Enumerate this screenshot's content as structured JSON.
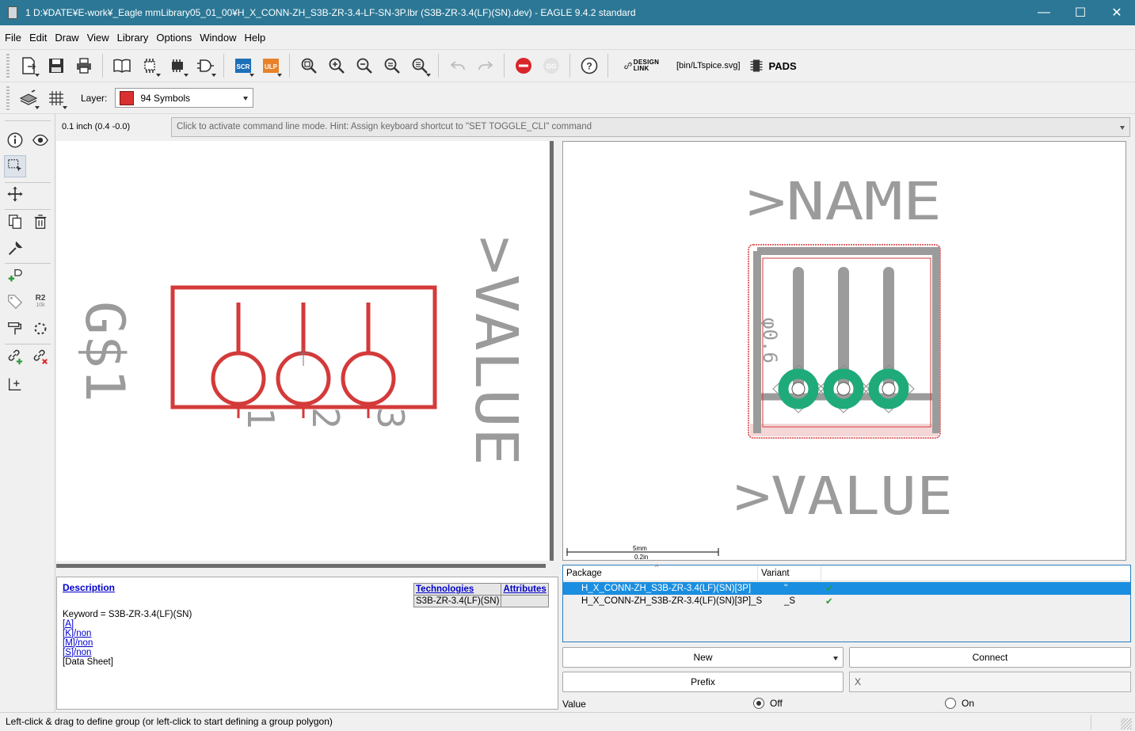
{
  "window": {
    "title": "1 D:¥DATE¥E-work¥_Eagle mmLibrary05_01_00¥H_X_CONN-ZH_S3B-ZR-3.4-LF-SN-3P.lbr (S3B-ZR-3.4(LF)(SN).dev) - EAGLE 9.4.2 standard",
    "minimize": "—",
    "maximize": "☐",
    "close": "✕"
  },
  "menu": [
    "File",
    "Edit",
    "Draw",
    "View",
    "Library",
    "Options",
    "Window",
    "Help"
  ],
  "toolbar": {
    "scr_label": "SCR",
    "ulp_label": "ULP",
    "design_link_label_1": "DESIGN",
    "design_link_label_2": "LINK",
    "script_label": "[bin/LTspice.svg]",
    "pads_label": "PADS",
    "colors": {
      "scr": "#1d6fb8",
      "ulp": "#e8822a",
      "stop": "#d9262b"
    }
  },
  "layerbar": {
    "label": "Layer:",
    "selected_layer": "94 Symbols",
    "swatch_color": "#d93131"
  },
  "coords": "0.1 inch (0.4 -0.0)",
  "command_line": {
    "placeholder": "Click to activate command line mode. Hint: Assign keyboard shortcut to \"SET TOGGLE_CLI\" command"
  },
  "lefttools": {
    "r2_label": "R2",
    "r2_value": "10k"
  },
  "symbol": {
    "name_text": "G$1",
    "value_text": ">VALUE",
    "pins": [
      "1",
      "2",
      "3"
    ],
    "line_color": "#d43a3a",
    "text_color": "#9b9b9b"
  },
  "package": {
    "name_text": ">NAME",
    "value_text": ">VALUE",
    "dimension_text": "φ0.6",
    "pad_color": "#1faa7a",
    "scale_mm": "5mm",
    "scale_in": "0.2in"
  },
  "description": {
    "title": "Description",
    "keyword": "Keyword = S3B-ZR-3.4(LF)(SN)",
    "links": [
      "[A]",
      "[K]/non",
      "[M]/non",
      "[S]/non"
    ],
    "datasheet": "[Data Sheet]",
    "tech_header": "Technologies",
    "attr_header": "Attributes",
    "tech_value": "S3B-ZR-3.4(LF)(SN)"
  },
  "package_table": {
    "col_package": "Package",
    "col_variant": "Variant",
    "sort_indicator": "^",
    "rows": [
      {
        "package": "H_X_CONN-ZH_S3B-ZR-3.4(LF)(SN)[3P]",
        "variant": "''",
        "check": "✔"
      },
      {
        "package": "H_X_CONN-ZH_S3B-ZR-3.4(LF)(SN)[3P]_S",
        "variant": "_S",
        "check": "✔"
      }
    ]
  },
  "buttons": {
    "new": "New",
    "connect": "Connect",
    "prefix": "Prefix",
    "prefix_value": "X"
  },
  "value_option": {
    "label": "Value",
    "off": "Off",
    "on": "On"
  },
  "status": "Left-click & drag to define group (or left-click to start defining a group polygon)"
}
